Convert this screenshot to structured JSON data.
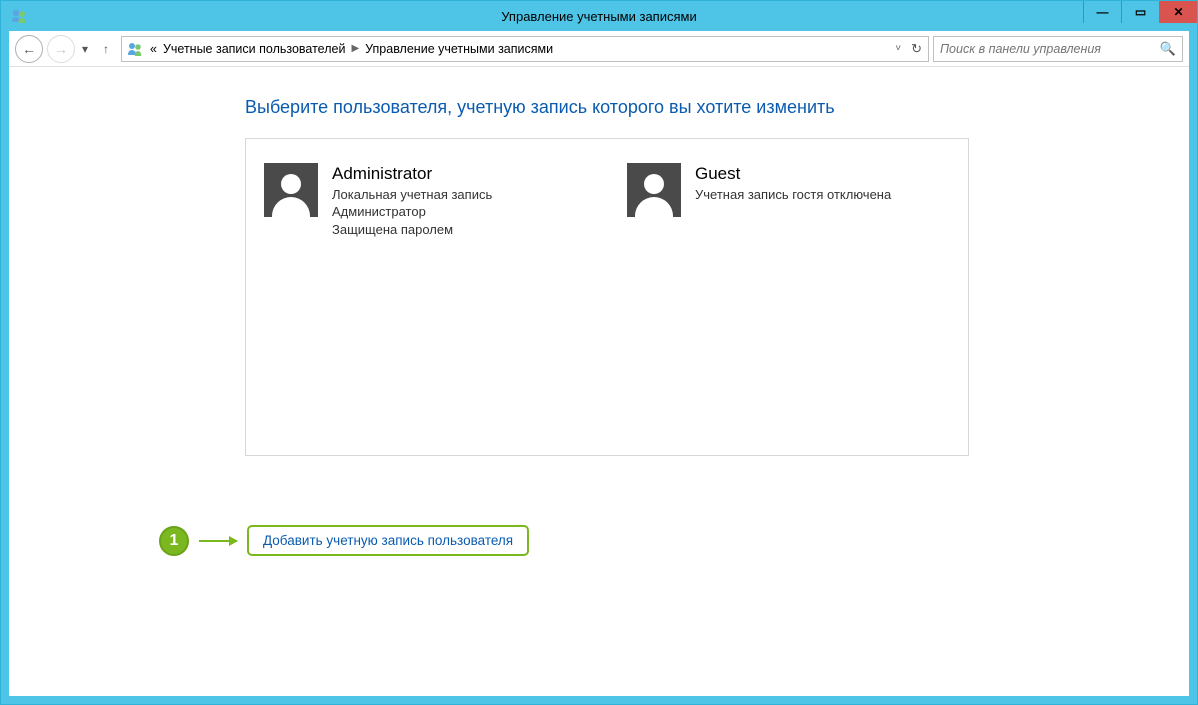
{
  "window": {
    "title": "Управление учетными записями"
  },
  "breadcrumb": {
    "prefix": "«",
    "seg1": "Учетные записи пользователей",
    "seg2": "Управление учетными записями"
  },
  "search": {
    "placeholder": "Поиск в панели управления"
  },
  "main": {
    "heading": "Выберите пользователя, учетную запись которого вы хотите изменить",
    "users": [
      {
        "name": "Administrator",
        "line1": "Локальная учетная запись",
        "line2": "Администратор",
        "line3": "Защищена паролем"
      },
      {
        "name": "Guest",
        "line1": "Учетная запись гостя отключена",
        "line2": "",
        "line3": ""
      }
    ],
    "add_user_link": "Добавить учетную запись пользователя"
  },
  "annotation": {
    "badge": "1"
  }
}
